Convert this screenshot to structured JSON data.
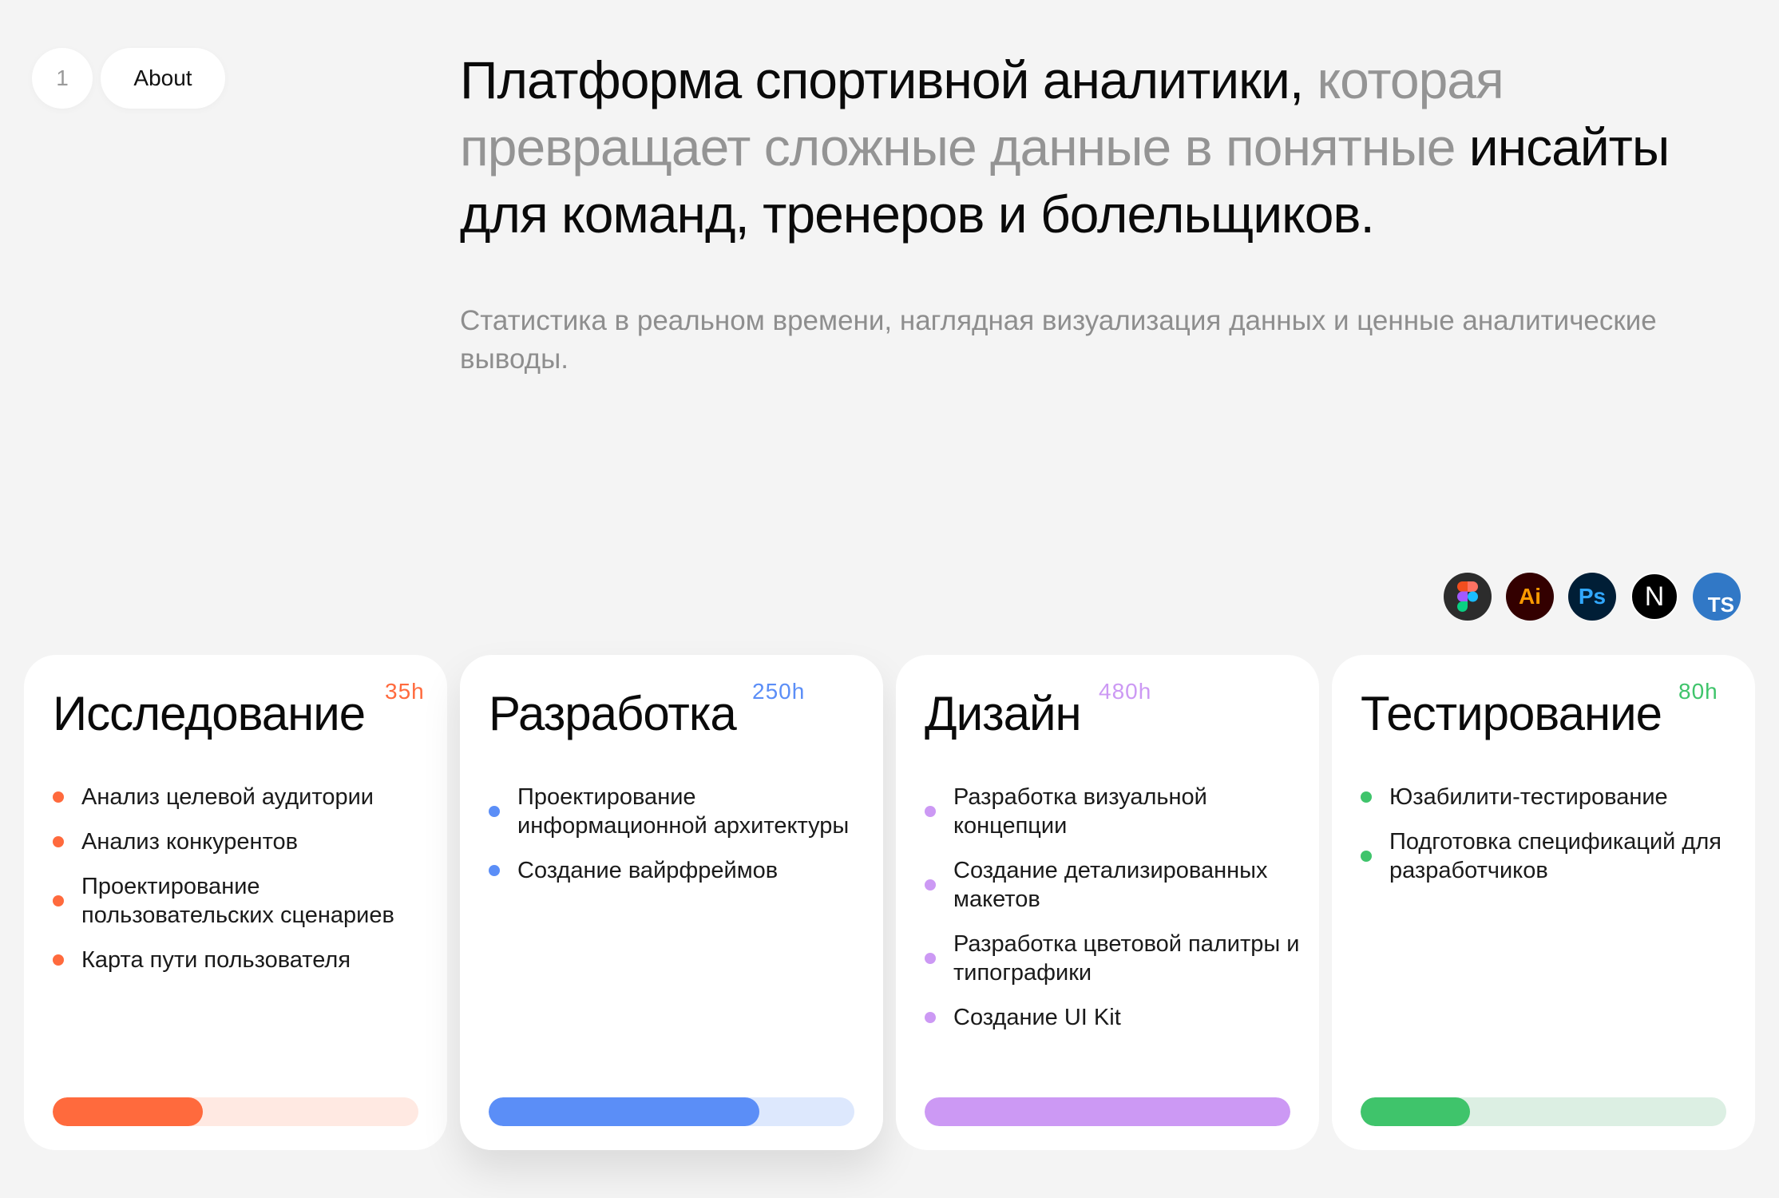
{
  "nav": {
    "number": "1",
    "about_label": "About"
  },
  "headline": {
    "part1": "Платформа спортивной аналитики,",
    "part2": " которая превращает сложные данные в понятные ",
    "part3": "инсайты для команд, тренеров и болельщиков."
  },
  "subtitle": "Статистика в реальном времени, наглядная визуализация данных и ценные аналитические выводы.",
  "tools": [
    {
      "name": "figma-icon",
      "label": ""
    },
    {
      "name": "illustrator-icon",
      "label": "Ai"
    },
    {
      "name": "photoshop-icon",
      "label": "Ps"
    },
    {
      "name": "nextjs-icon",
      "label": "N"
    },
    {
      "name": "typescript-icon",
      "label": "TS"
    }
  ],
  "cards": [
    {
      "title": "Исследование",
      "hours": "35h",
      "color": "#ff6a3d",
      "track": "#ffe9e2",
      "progress": 0.41,
      "items": [
        "Анализ целевой аудитории",
        "Анализ конкурентов",
        "Проектирование пользовательских сценариев",
        "Карта пути пользователя"
      ]
    },
    {
      "title": "Разработка",
      "hours": "250h",
      "color": "#5b8ef7",
      "track": "#dde8fd",
      "progress": 0.74,
      "items": [
        "Проектирование информационной архитектуры",
        "Создание вайрфреймов"
      ]
    },
    {
      "title": "Дизайн",
      "hours": "480h",
      "color": "#cc99f4",
      "track": "#f3e8fc",
      "progress": 1.0,
      "items": [
        "Разработка визуальной концепции",
        "Создание детализированных макетов",
        "Разработка цветовой палитры и типографики",
        "Создание UI Kit"
      ]
    },
    {
      "title": "Тестирование",
      "hours": "80h",
      "color": "#3fc46b",
      "track": "#dcefe3",
      "progress": 0.3,
      "items": [
        "Юзабилити-тестирование",
        "Подготовка спецификаций для разработчиков"
      ]
    }
  ]
}
